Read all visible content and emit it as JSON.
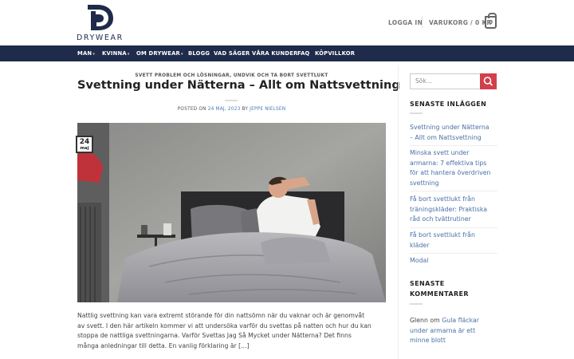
{
  "brand": {
    "name": "DRYWEAR"
  },
  "header": {
    "login_label": "LOGGA IN",
    "cart_label": "VARUKORG / 0 KR",
    "cart_count": "0"
  },
  "nav": {
    "items": [
      {
        "label": "MAN",
        "dropdown": true
      },
      {
        "label": "KVINNA",
        "dropdown": true
      },
      {
        "label": "OM DRYWEAR",
        "dropdown": true
      },
      {
        "label": "BLOGG",
        "dropdown": false
      },
      {
        "label": "VAD SÄGER VÅRA KUNDER",
        "dropdown": false
      },
      {
        "label": "FAQ",
        "dropdown": false
      },
      {
        "label": "KÖPVILLKOR",
        "dropdown": false
      }
    ]
  },
  "article": {
    "categories": "SVETT PROBLEM OCH LÖSNINGAR, UNDVIK OCH TA BORT SVETTLUKT",
    "title": "Svettning under Nätterna – Allt om Nattsvettning",
    "posted_on": "POSTED ON",
    "date": "24 MAJ, 2023",
    "by": "BY",
    "author": "JEPPE NIELSEN",
    "badge_day": "24",
    "badge_month": "maj",
    "excerpt_lines": [
      "Nattlig svettning kan vara extremt störande för din nattsömn när du vaknar och är genomvåt",
      "av svett. I den här artikeln kommer vi att undersöka varför du svettas på natten och hur du kan",
      "stoppa de nattliga svettningarna. Varför Svettas Jag Så Mycket under Nätterna? Det finns",
      "många anledningar till detta. En vanlig förklaring är [...]"
    ]
  },
  "sidebar": {
    "search_placeholder": "Sök...",
    "recent_posts_title": "SENASTE INLÄGGEN",
    "recent_posts": [
      {
        "lines": [
          "Svettning under Nätterna",
          "– Allt om Nattsvettning"
        ]
      },
      {
        "lines": [
          "Minska svett under",
          "armarna: 7 effektiva tips",
          "för att hantera överdriven",
          "svettning"
        ]
      },
      {
        "lines": [
          "Få bort svettlukt från",
          "träningskläder: Praktiska",
          "råd och tvättrutiner"
        ]
      },
      {
        "lines": [
          "Få bort svettlukt från",
          "kläder"
        ]
      },
      {
        "lines": [
          "Modal"
        ]
      }
    ],
    "recent_comments_title_lines": [
      "SENASTE",
      "KOMMENTARER"
    ],
    "comment": {
      "author": "Glenn",
      "on": "om",
      "post_lines": [
        "Gula fläckar",
        "under armarna är ett",
        "minne blott"
      ]
    }
  },
  "colors": {
    "nav_bg": "#1e2b4a",
    "search_button": "#d33e4b",
    "link": "#4a6fa5"
  }
}
